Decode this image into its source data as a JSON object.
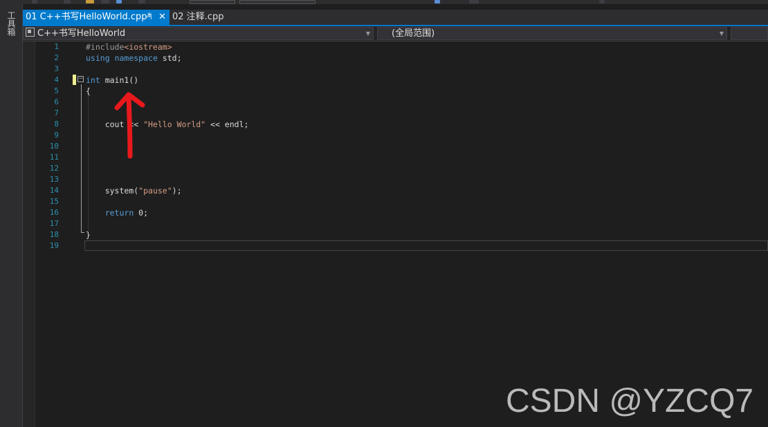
{
  "toolbox": {
    "label": "工具箱"
  },
  "tabs": [
    {
      "label": "01 C++书写HelloWorld.cpp*",
      "active": true
    },
    {
      "label": "02 注释.cpp",
      "active": false
    }
  ],
  "tab_icons": {
    "pin": "pin-icon",
    "close": "close-icon"
  },
  "navbar": {
    "project": "C++书写HelloWorld",
    "scope": "(全局范围)",
    "member": ""
  },
  "editor": {
    "line_numbers": [
      "1",
      "2",
      "3",
      "4",
      "5",
      "6",
      "7",
      "8",
      "9",
      "10",
      "11",
      "12",
      "13",
      "14",
      "15",
      "16",
      "17",
      "18",
      "19"
    ],
    "lines": [
      {
        "n": "1",
        "tokens": [
          {
            "t": "#include",
            "c": "pre"
          },
          {
            "t": "<iostream>",
            "c": "inc"
          }
        ]
      },
      {
        "n": "2",
        "tokens": [
          {
            "t": "using",
            "c": "kw"
          },
          {
            "t": " "
          },
          {
            "t": "namespace",
            "c": "kw"
          },
          {
            "t": " std;"
          }
        ]
      },
      {
        "n": "3",
        "tokens": []
      },
      {
        "n": "4",
        "tokens": [
          {
            "t": "int",
            "c": "kw"
          },
          {
            "t": " main1()"
          }
        ]
      },
      {
        "n": "5",
        "tokens": [
          {
            "t": "{"
          }
        ]
      },
      {
        "n": "6",
        "tokens": []
      },
      {
        "n": "7",
        "tokens": []
      },
      {
        "n": "8",
        "tokens": [
          {
            "t": "    cout << "
          },
          {
            "t": "\"Hello World\"",
            "c": "str"
          },
          {
            "t": " << endl;"
          }
        ]
      },
      {
        "n": "9",
        "tokens": []
      },
      {
        "n": "10",
        "tokens": []
      },
      {
        "n": "11",
        "tokens": []
      },
      {
        "n": "12",
        "tokens": []
      },
      {
        "n": "13",
        "tokens": []
      },
      {
        "n": "14",
        "tokens": [
          {
            "t": "    system("
          },
          {
            "t": "\"pause\"",
            "c": "str"
          },
          {
            "t": ");"
          }
        ]
      },
      {
        "n": "15",
        "tokens": []
      },
      {
        "n": "16",
        "tokens": [
          {
            "t": "    "
          },
          {
            "t": "return",
            "c": "kw"
          },
          {
            "t": " 0;"
          }
        ]
      },
      {
        "n": "17",
        "tokens": []
      },
      {
        "n": "18",
        "tokens": [
          {
            "t": "}"
          }
        ]
      },
      {
        "n": "19",
        "tokens": []
      }
    ]
  },
  "annotation": {
    "arrow_color": "#e8191c"
  },
  "watermark": "CSDN @YZCQ7",
  "colors": {
    "accent": "#007acc",
    "keyword": "#569cd6",
    "string": "#d69d85",
    "line_number": "#2b91af"
  }
}
